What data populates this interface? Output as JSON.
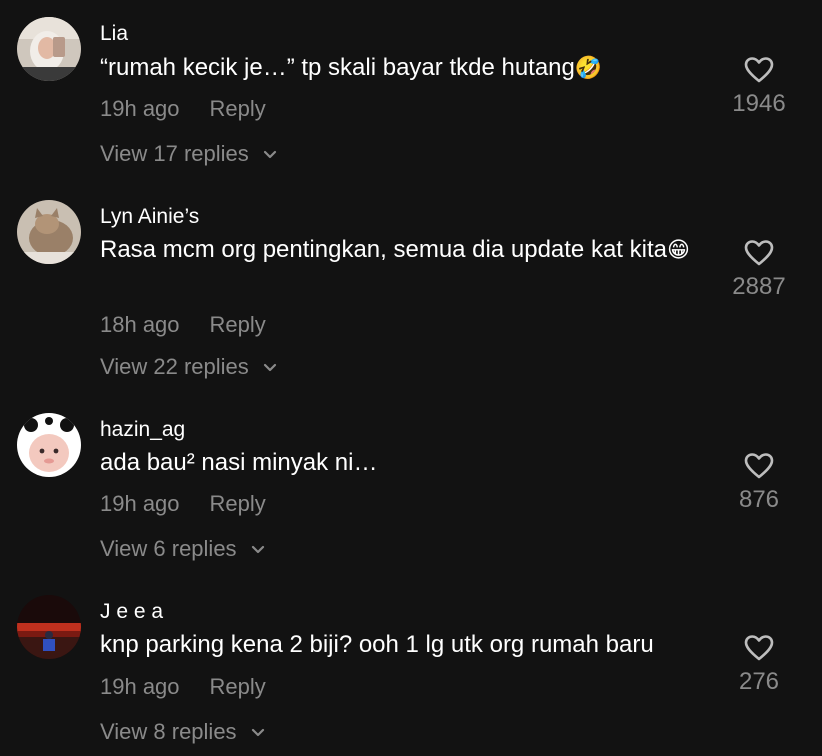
{
  "comments": [
    {
      "username": "Lia",
      "text": "“rumah kecik je…” tp skali bayar tkde hutang",
      "emoji": "🤣",
      "time": "19h ago",
      "reply_label": "Reply",
      "view_replies": "View 17 replies",
      "likes": "1946",
      "avatar": "avatar-mirror-selfie"
    },
    {
      "username": "Lyn Ainie’s",
      "text": "Rasa mcm org pentingkan, semua dia update kat kita",
      "emoji": "😁",
      "time": "18h ago",
      "reply_label": "Reply",
      "view_replies": "View 22 replies",
      "likes": "2887",
      "avatar": "avatar-cat"
    },
    {
      "username": "hazin_ag",
      "text": "ada bau² nasi minyak ni…",
      "emoji": "",
      "time": "19h ago",
      "reply_label": "Reply",
      "view_replies": "View 6 replies",
      "likes": "876",
      "avatar": "avatar-panda-hood"
    },
    {
      "username": "J e e a",
      "text": "knp parking kena 2 biji? ooh 1 lg utk org rumah baru",
      "emoji": "",
      "time": "19h ago",
      "reply_label": "Reply",
      "view_replies": "View 8 replies",
      "likes": "276",
      "avatar": "avatar-sunset"
    }
  ],
  "icons": {
    "like": "heart-outline-icon",
    "expand": "chevron-down-icon"
  },
  "colors": {
    "background": "#121212",
    "primary_text": "#ffffff",
    "secondary_text": "#8a8a8a"
  }
}
